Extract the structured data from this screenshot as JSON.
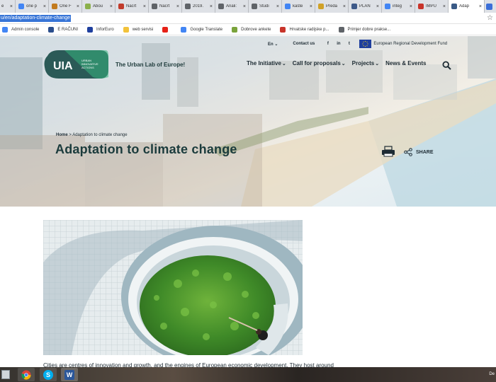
{
  "browser": {
    "tabs": [
      {
        "label": "e",
        "favicon_color": "#e0a431"
      },
      {
        "label": "one p",
        "favicon_color": "#4285f4"
      },
      {
        "label": "One F",
        "favicon_color": "#c27b1e"
      },
      {
        "label": "Abou",
        "favicon_color": "#8bb04b"
      },
      {
        "label": "Nacrt",
        "favicon_color": "#c13b2b"
      },
      {
        "label": "Nacrt",
        "favicon_color": "#5f6368"
      },
      {
        "label": "2019.",
        "favicon_color": "#5f6368"
      },
      {
        "label": "Anali:",
        "favicon_color": "#5f6368"
      },
      {
        "label": "Studi",
        "favicon_color": "#5f6368"
      },
      {
        "label": "kašte",
        "favicon_color": "#4285f4"
      },
      {
        "label": "Preda",
        "favicon_color": "#d0a127"
      },
      {
        "label": "PLAN",
        "favicon_color": "#3e5a89"
      },
      {
        "label": "integ",
        "favicon_color": "#4285f4"
      },
      {
        "label": "IMPU",
        "favicon_color": "#c8342a"
      },
      {
        "label": "Adap",
        "favicon_color": "#3a5a86",
        "active": true
      }
    ],
    "url_selected": "u/en/adaptation-climate-change",
    "bookmarks": [
      {
        "label": "Admin console",
        "icon": "google-icon",
        "color": "#4285f4"
      },
      {
        "label": "E RAČUNI",
        "icon": "eracuni-icon",
        "color": "#2b4e8c"
      },
      {
        "label": "InforEuro",
        "icon": "eu-flag-icon",
        "color": "#1f3f9e"
      },
      {
        "label": "web servisi",
        "icon": "folder-icon",
        "color": "#f2c23a"
      },
      {
        "label": "",
        "icon": "youtube-icon",
        "color": "#e62117"
      },
      {
        "label": "Google Translate",
        "icon": "translate-icon",
        "color": "#4285f4"
      },
      {
        "label": "Dobrove ankete",
        "icon": "survey-icon",
        "color": "#7aa33b"
      },
      {
        "label": "Hrvatske radijske p...",
        "icon": "hr-flag-icon",
        "color": "#c8342a"
      },
      {
        "label": "Primjer dobre prakse...",
        "icon": "globe-icon",
        "color": "#5f6368"
      }
    ]
  },
  "site": {
    "logo_text": "UIA",
    "logo_sub": [
      "URBAN",
      "INNOVATIVE",
      "ACTIONS"
    ],
    "tagline": "The Urban Lab of Europe!",
    "lang": "En",
    "contact": "Contact us",
    "social": [
      "f",
      "in",
      "t"
    ],
    "eu_fund": "European Regional Development Fund",
    "nav": [
      "The Initiative",
      "Call for proposals",
      "Projects",
      "News & Events"
    ],
    "breadcrumb_home": "Home",
    "breadcrumb_sep": ">",
    "breadcrumb_current": "Adaptation to climate change",
    "title": "Adaptation to climate change",
    "share": "SHARE",
    "intro": "Cities are centres of innovation and growth, and the engines of European economic development. They host around"
  },
  "taskbar": {
    "clock": "De"
  },
  "colors": {
    "brand": "#1b3b3c",
    "logo": "#2b5a57",
    "accent": "#37b57d",
    "selection": "#3875d7"
  }
}
